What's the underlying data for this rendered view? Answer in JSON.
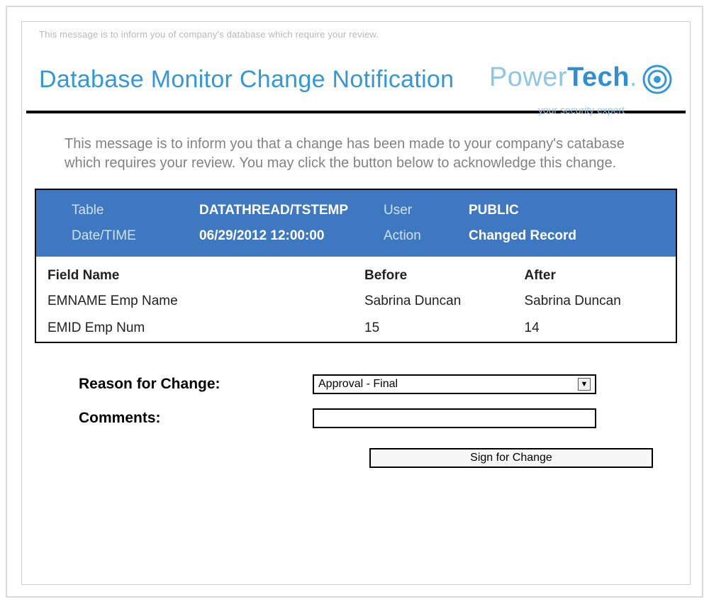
{
  "preheader": "This message is to inform you of company's database which require your review.",
  "page_title": "Database Monitor Change Notification",
  "logo": {
    "word1": "Power",
    "word2": "Tech",
    "tagline": "your security expert"
  },
  "intro": "This message is to inform you that a change has been made to your company's catabase which requires your review. You may click the button below to acknowledge this change.",
  "summary": {
    "table_label": "Table",
    "table_value": "DATATHREAD/TSTEMP",
    "user_label": "User",
    "user_value": "PUBLIC",
    "datetime_label": "Date/TIME",
    "datetime_value": "06/29/2012 12:00:00",
    "action_label": "Action",
    "action_value": "Changed Record"
  },
  "columns": {
    "field": "Field Name",
    "before": "Before",
    "after": "After"
  },
  "rows": [
    {
      "field": "EMNAME Emp Name",
      "before": "Sabrina Duncan",
      "after": "Sabrina Duncan"
    },
    {
      "field": "EMID Emp Num",
      "before": "15",
      "after": "14"
    }
  ],
  "form": {
    "reason_label": "Reason for Change:",
    "reason_value": "Approval - Final",
    "comments_label": "Comments:",
    "comments_value": "",
    "submit_label": "Sign for Change"
  }
}
